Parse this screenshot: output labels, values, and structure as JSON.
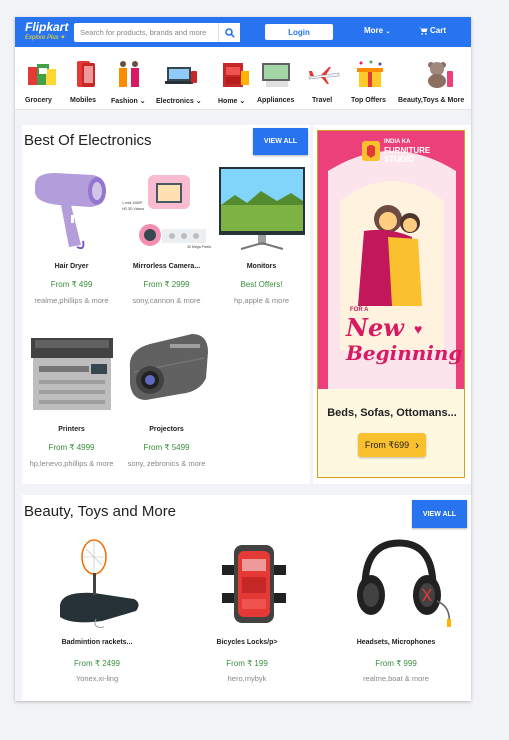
{
  "header": {
    "logo_text": "Flipkart",
    "logo_subtext": "Explore Plus",
    "search_placeholder": "Search for products, brands and more",
    "login_label": "Login",
    "more_label": "More",
    "cart_label": "Cart",
    "brand_color": "#2874f0"
  },
  "categories": [
    {
      "label": "Grocery",
      "icon": "grocery-icon"
    },
    {
      "label": "Mobiles",
      "icon": "mobile-icon"
    },
    {
      "label": "Fashion",
      "icon": "fashion-icon",
      "dropdown": true
    },
    {
      "label": "Electronics",
      "icon": "electronics-icon",
      "dropdown": true
    },
    {
      "label": "Home",
      "icon": "home-icon",
      "dropdown": true
    },
    {
      "label": "Appliances",
      "icon": "appliances-icon"
    },
    {
      "label": "Travel",
      "icon": "airplane-icon"
    },
    {
      "label": "Top Offers",
      "icon": "offers-icon"
    },
    {
      "label": "Beauty,Toys & More",
      "icon": "toys-icon"
    }
  ],
  "electronics": {
    "title": "Best Of Electronics",
    "view_all": "VIEW ALL",
    "products": [
      {
        "name": "Hair Dryer",
        "price": "From ₹ 499",
        "brands": "realme,phillips & more"
      },
      {
        "name": "Mirrorless Camera...",
        "price": "From ₹ 2999",
        "brands": "sony,cannon & more"
      },
      {
        "name": "Monitors",
        "price": "Best Offers!",
        "brands": "hp,apple & more"
      },
      {
        "name": "Printers",
        "price": "From ₹ 4999",
        "brands": "hp,lenevo,phillips & more"
      },
      {
        "name": "Projectors",
        "price": "From ₹ 5499",
        "brands": "sony, zebronics & more"
      }
    ],
    "camera_badges": [
      "1 mini 1080P",
      "HD 3D Videos",
      "32 Mega Pixels"
    ]
  },
  "ad": {
    "brand_line1": "INDIA KA",
    "brand_line2": "FURNITURE",
    "brand_line3": "STUDIO",
    "headline_small": "FOR A",
    "headline_word1": "New",
    "headline_word2": "Beginning",
    "products": "Beds, Sofas, Ottomans...",
    "price_cta": "From ₹699"
  },
  "beauty": {
    "title": "Beauty, Toys and More",
    "view_all": "VIEW ALL",
    "products": [
      {
        "name": "Badmintion rackets...",
        "price": "From ₹ 2499",
        "brands": "Yonex,xi-ling"
      },
      {
        "name": "Bicycles Locks/p>",
        "price": "From ₹ 199",
        "brands": "hero,mybyk"
      },
      {
        "name": "Headsets, Microphones",
        "price": "From ₹ 999",
        "brands": "realme,boat & more"
      }
    ]
  }
}
